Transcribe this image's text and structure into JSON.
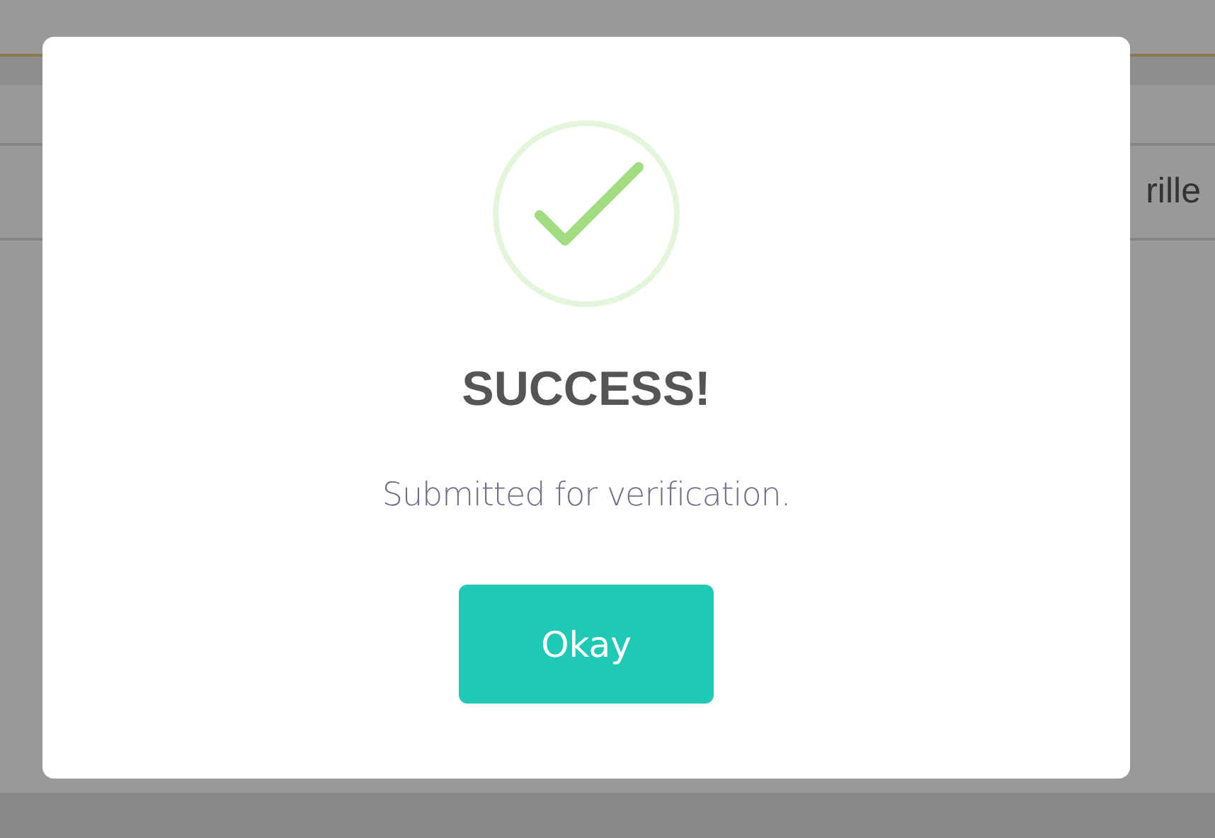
{
  "background": {
    "row_text": "rille"
  },
  "dialog": {
    "title": "SUCCESS!",
    "message": "Submitted for verification.",
    "button": "Okay"
  }
}
